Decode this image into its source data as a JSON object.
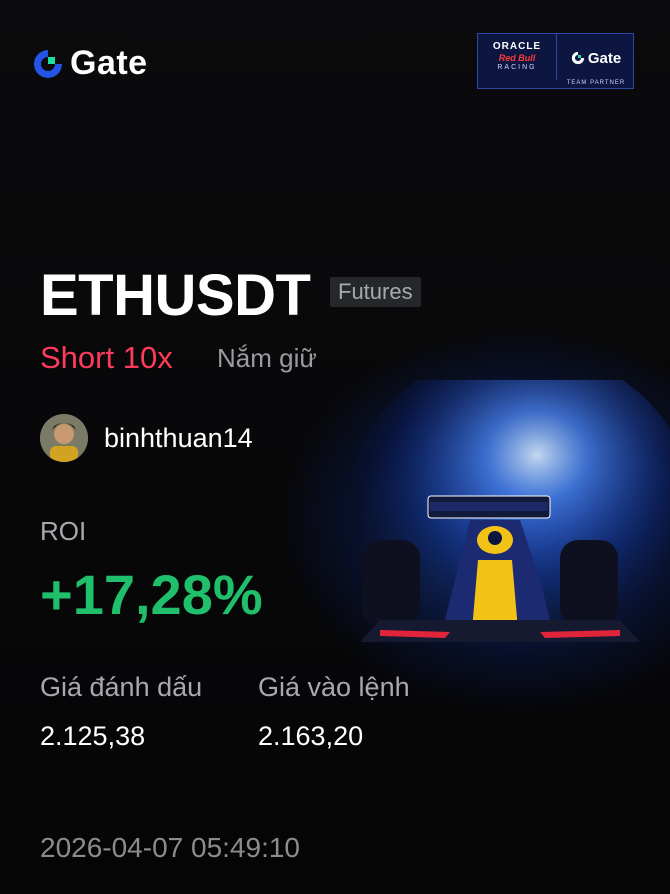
{
  "brand": {
    "name": "Gate",
    "icon": "gate-logo-icon"
  },
  "partner": {
    "oracle": "ORACLE",
    "redbull": "Red Bull",
    "racing": "RACING",
    "gate": "Gate",
    "team_partner": "TEAM PARTNER"
  },
  "position": {
    "symbol": "ETHUSDT",
    "market": "Futures",
    "direction": "Short 10x",
    "status": "Nắm giữ"
  },
  "user": {
    "name": "binhthuan14"
  },
  "roi": {
    "label": "ROI",
    "value": "+17,28%"
  },
  "prices": {
    "mark_label": "Giá đánh dấu",
    "mark_value": "2.125,38",
    "entry_label": "Giá vào lệnh",
    "entry_value": "2.163,20"
  },
  "timestamp": "2026-04-07 05:49:10",
  "colors": {
    "short": "#ff3b5c",
    "roi_positive": "#1fbf6b",
    "brand_blue": "#2354e6",
    "background": "#000000"
  }
}
